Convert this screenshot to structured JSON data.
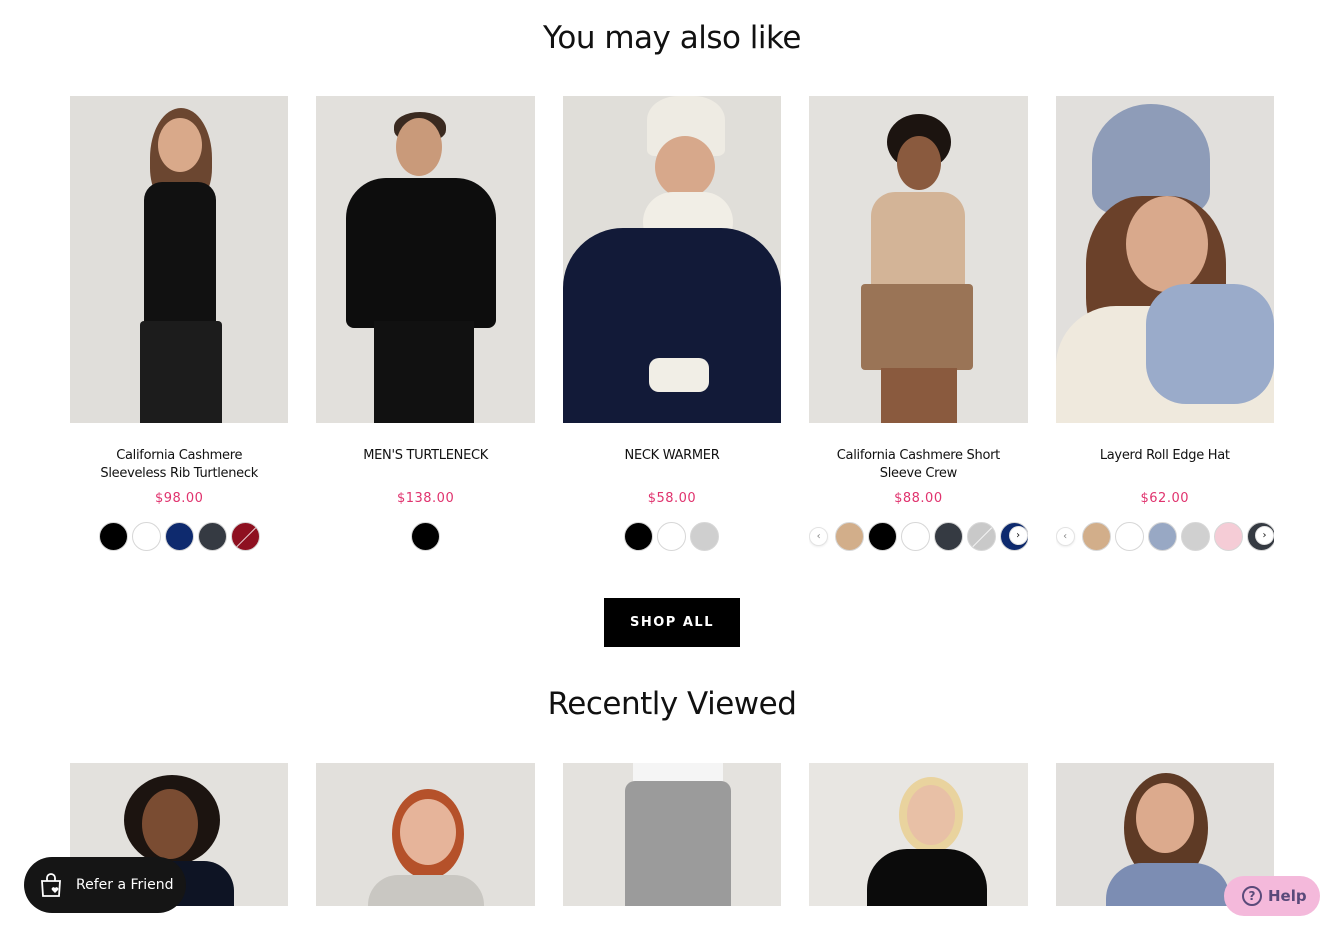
{
  "section_also": {
    "title": "You may also like"
  },
  "products": [
    {
      "name": "California Cashmere Sleeveless Rib Turtleneck",
      "price": "$98.00",
      "swatches": [
        "#000000",
        "#ffffff",
        "#0e2a6e",
        "#353a42",
        "#8e1020"
      ],
      "slashed": [
        4
      ],
      "scroll": false
    },
    {
      "name": "MEN'S TURTLENECK",
      "price": "$138.00",
      "swatches": [
        "#000000"
      ],
      "slashed": [],
      "scroll": false
    },
    {
      "name": "NECK WARMER",
      "price": "$58.00",
      "swatches": [
        "#000000",
        "#ffffff",
        "#cfcfcf"
      ],
      "slashed": [],
      "scroll": false
    },
    {
      "name": "California Cashmere Short Sleeve Crew",
      "price": "$88.00",
      "swatches": [
        "#d2ae8a",
        "#000000",
        "#ffffff",
        "#353a42",
        "#c9c9c9",
        "#0e2a6e"
      ],
      "slashed": [
        4
      ],
      "scroll": true
    },
    {
      "name": "Layerd Roll Edge Hat",
      "price": "$62.00",
      "swatches": [
        "#d2ae8a",
        "#ffffff",
        "#98a8c4",
        "#d0d0d0",
        "#f5ccd6",
        "#353a42"
      ],
      "slashed": [],
      "scroll": true
    }
  ],
  "shop_all_label": "SHOP ALL",
  "section_recent": {
    "title": "Recently Viewed"
  },
  "recent_count": 5,
  "refer_label": "Refer a Friend",
  "help_label": "Help",
  "icons": {
    "refer": "shopping-bag-heart-icon",
    "help": "question-circle-icon",
    "prev": "chevron-left-icon",
    "next": "chevron-right-icon"
  }
}
